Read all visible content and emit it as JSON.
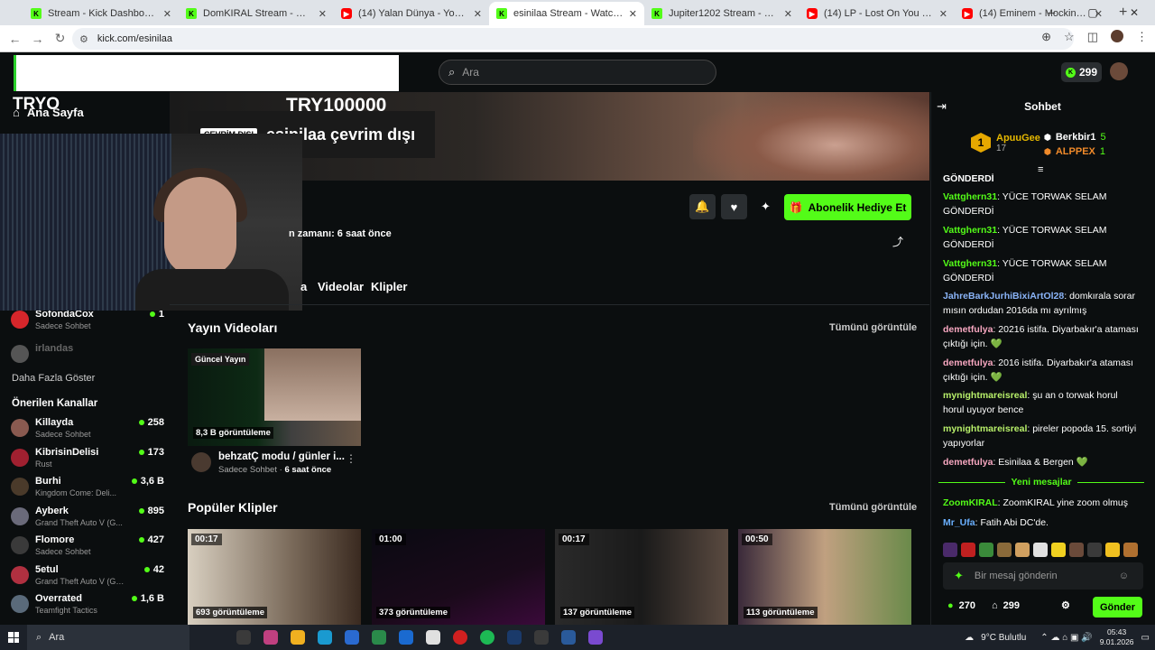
{
  "browser": {
    "tabs": [
      {
        "title": "Stream - Kick Dashboard",
        "icon": "kick-icon",
        "active": false
      },
      {
        "title": "DomKIRAL Stream - Watch Live",
        "icon": "kick-icon",
        "active": false
      },
      {
        "title": "(14) Yalan Dünya - YouTube",
        "icon": "youtube-icon",
        "active": false
      },
      {
        "title": "esinilaa Stream - Watch Live on",
        "icon": "kick-icon",
        "active": true
      },
      {
        "title": "Jupiter1202 Stream - Watch Liv",
        "icon": "kick-icon",
        "active": false
      },
      {
        "title": "(14) LP - Lost On You (Official M",
        "icon": "youtube-icon",
        "active": false
      },
      {
        "title": "(14) Eminem - Mockingbird [Of",
        "icon": "youtube-icon",
        "active": false
      }
    ],
    "url": "kick.com/esinilaa"
  },
  "header": {
    "search_placeholder": "Ara",
    "points": "299"
  },
  "sidebar": {
    "home_label": "Ana Sayfa",
    "overlay_tryo": "TRYO",
    "followed": [
      {
        "name": "SofondaCox",
        "sub": "Sadece Sohbet",
        "viewers": "1",
        "avatar_color": "#d6262b"
      },
      {
        "name": "irlandas",
        "sub": "",
        "viewers": "",
        "avatar_color": "#555555"
      }
    ],
    "show_more": "Daha Fazla Göster",
    "recommended_title": "Önerilen Kanallar",
    "recommended": [
      {
        "name": "Killayda",
        "sub": "Sadece Sohbet",
        "viewers": "258",
        "avatar_color": "#8a5a50"
      },
      {
        "name": "KibrisinDelisi",
        "sub": "Rust",
        "viewers": "173",
        "avatar_color": "#a02030"
      },
      {
        "name": "Burhi",
        "sub": "Kingdom Come: Deli...",
        "viewers": "3,6 B",
        "avatar_color": "#4a3a2a"
      },
      {
        "name": "Ayberk",
        "sub": "Grand Theft Auto V (G...",
        "viewers": "895",
        "avatar_color": "#6a6a7a"
      },
      {
        "name": "Flomore",
        "sub": "Sadece Sohbet",
        "viewers": "427",
        "avatar_color": "#3a3a3a"
      },
      {
        "name": "5etul",
        "sub": "Grand Theft Auto V (GTA)",
        "viewers": "42",
        "avatar_color": "#b03040"
      },
      {
        "name": "Overrated",
        "sub": "Teamfight Tactics",
        "viewers": "1,6 B",
        "avatar_color": "#5a6a7a"
      }
    ]
  },
  "channel": {
    "offline_tag": "ÇEVRİM DIŞI",
    "offline_text": "esinilaa çevrim dışı",
    "overlay_try": "TRY100000",
    "last_live": "n zamanı: 6 saat önce",
    "subscribe_gift": "Abonelik Hediye Et",
    "tabs": [
      "a",
      "Videolar",
      "Klipler"
    ]
  },
  "videos": {
    "title": "Yayın Videoları",
    "see_all": "Tümünü görüntüle",
    "items": [
      {
        "badge": "Güncel Yayın",
        "views": "8,3 B görüntüleme",
        "title": "behzatÇ modu / günler i...",
        "category": "Sadece Sohbet",
        "ago": "6 saat önce"
      }
    ]
  },
  "clips": {
    "title": "Popüler Klipler",
    "see_all": "Tümünü görüntüle",
    "items": [
      {
        "duration": "00:17",
        "views": "693 görüntüleme"
      },
      {
        "duration": "01:00",
        "views": "373 görüntüleme"
      },
      {
        "duration": "00:17",
        "views": "137 görüntüleme"
      },
      {
        "duration": "00:50",
        "views": "113 görüntüleme"
      }
    ]
  },
  "chat": {
    "title": "Sohbet",
    "leader": {
      "rank": "1",
      "name": "ApuuGee",
      "count": "17"
    },
    "gifters": [
      {
        "name": "Berkbir1",
        "count": "5",
        "color": "#ffffff"
      },
      {
        "name": "ALPPEX",
        "count": "1",
        "color": "#f08a2a"
      }
    ],
    "partial_top": "GÖNDERDİ",
    "messages": [
      {
        "user": "Vattghern31",
        "color": "#53fc18",
        "text": "YÜCE  TORWAK  SELAM GÖNDERDİ"
      },
      {
        "user": "Vattghern31",
        "color": "#53fc18",
        "text": "YÜCE  TORWAK  SELAM GÖNDERDİ"
      },
      {
        "user": "Vattghern31",
        "color": "#53fc18",
        "text": "YÜCE  TORWAK  SELAM GÖNDERDİ"
      },
      {
        "user": "JahreBarkJurhiBixiArtOl28",
        "color": "#8ab4f8",
        "text": "domkırala sorar mısın ordudan 2016da mı ayrılmış"
      },
      {
        "user": "demetfulya",
        "color": "#f7a7c0",
        "text": "20216 istifa. Diyarbakır'a ataması çıktığı için. 💚"
      },
      {
        "user": "demetfulya",
        "color": "#f7a7c0",
        "text": "2016 istifa. Diyarbakır'a ataması çıktığı için. 💚"
      },
      {
        "user": "mynightmareisreal",
        "color": "#b8f06a",
        "text": "şu an o torwak horul horul uyuyor bence"
      },
      {
        "user": "mynightmareisreal",
        "color": "#b8f06a",
        "text": "pireler popoda 15. sortiyi yapıyorlar"
      },
      {
        "user": "demetfulya",
        "color": "#f7a7c0",
        "text": "Esinilaa & Bergen 💚"
      }
    ],
    "new_messages": "Yeni mesajlar",
    "after": [
      {
        "user": "ZoomKIRAL",
        "color": "#53fc18",
        "text": "ZoomKIRAL yine zoom olmuş"
      },
      {
        "user": "Mr_Ufa",
        "color": "#6ab0ff",
        "text": "Fatih Abi DC'de."
      }
    ],
    "input_placeholder": "Bir mesaj gönderin",
    "coins": "270",
    "points": "299",
    "send": "Gönder"
  },
  "taskbar": {
    "search": "Ara",
    "weather": "9°C  Bulutlu",
    "time": "05:43",
    "date": "9.01.2026"
  }
}
